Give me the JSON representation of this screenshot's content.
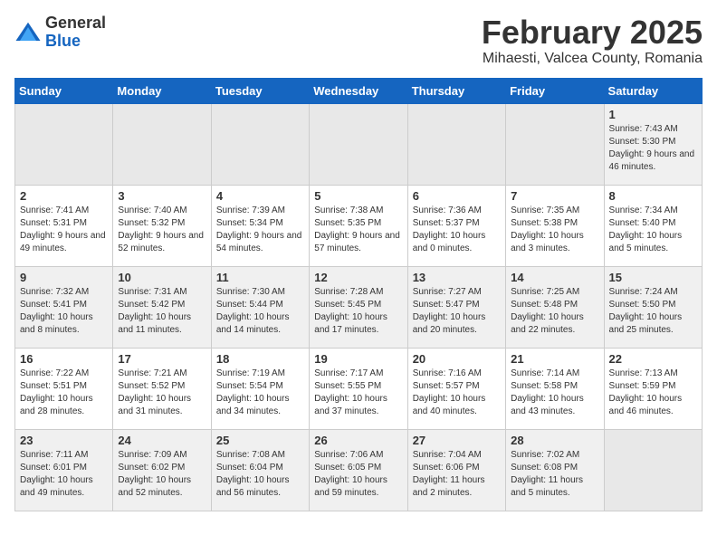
{
  "header": {
    "logo_general": "General",
    "logo_blue": "Blue",
    "title": "February 2025",
    "subtitle": "Mihaesti, Valcea County, Romania"
  },
  "weekdays": [
    "Sunday",
    "Monday",
    "Tuesday",
    "Wednesday",
    "Thursday",
    "Friday",
    "Saturday"
  ],
  "weeks": [
    [
      {
        "day": "",
        "empty": true
      },
      {
        "day": "",
        "empty": true
      },
      {
        "day": "",
        "empty": true
      },
      {
        "day": "",
        "empty": true
      },
      {
        "day": "",
        "empty": true
      },
      {
        "day": "",
        "empty": true
      },
      {
        "day": "1",
        "info": "Sunrise: 7:43 AM\nSunset: 5:30 PM\nDaylight: 9 hours and 46 minutes."
      }
    ],
    [
      {
        "day": "2",
        "info": "Sunrise: 7:41 AM\nSunset: 5:31 PM\nDaylight: 9 hours and 49 minutes."
      },
      {
        "day": "3",
        "info": "Sunrise: 7:40 AM\nSunset: 5:32 PM\nDaylight: 9 hours and 52 minutes."
      },
      {
        "day": "4",
        "info": "Sunrise: 7:39 AM\nSunset: 5:34 PM\nDaylight: 9 hours and 54 minutes."
      },
      {
        "day": "5",
        "info": "Sunrise: 7:38 AM\nSunset: 5:35 PM\nDaylight: 9 hours and 57 minutes."
      },
      {
        "day": "6",
        "info": "Sunrise: 7:36 AM\nSunset: 5:37 PM\nDaylight: 10 hours and 0 minutes."
      },
      {
        "day": "7",
        "info": "Sunrise: 7:35 AM\nSunset: 5:38 PM\nDaylight: 10 hours and 3 minutes."
      },
      {
        "day": "8",
        "info": "Sunrise: 7:34 AM\nSunset: 5:40 PM\nDaylight: 10 hours and 5 minutes."
      }
    ],
    [
      {
        "day": "9",
        "info": "Sunrise: 7:32 AM\nSunset: 5:41 PM\nDaylight: 10 hours and 8 minutes."
      },
      {
        "day": "10",
        "info": "Sunrise: 7:31 AM\nSunset: 5:42 PM\nDaylight: 10 hours and 11 minutes."
      },
      {
        "day": "11",
        "info": "Sunrise: 7:30 AM\nSunset: 5:44 PM\nDaylight: 10 hours and 14 minutes."
      },
      {
        "day": "12",
        "info": "Sunrise: 7:28 AM\nSunset: 5:45 PM\nDaylight: 10 hours and 17 minutes."
      },
      {
        "day": "13",
        "info": "Sunrise: 7:27 AM\nSunset: 5:47 PM\nDaylight: 10 hours and 20 minutes."
      },
      {
        "day": "14",
        "info": "Sunrise: 7:25 AM\nSunset: 5:48 PM\nDaylight: 10 hours and 22 minutes."
      },
      {
        "day": "15",
        "info": "Sunrise: 7:24 AM\nSunset: 5:50 PM\nDaylight: 10 hours and 25 minutes."
      }
    ],
    [
      {
        "day": "16",
        "info": "Sunrise: 7:22 AM\nSunset: 5:51 PM\nDaylight: 10 hours and 28 minutes."
      },
      {
        "day": "17",
        "info": "Sunrise: 7:21 AM\nSunset: 5:52 PM\nDaylight: 10 hours and 31 minutes."
      },
      {
        "day": "18",
        "info": "Sunrise: 7:19 AM\nSunset: 5:54 PM\nDaylight: 10 hours and 34 minutes."
      },
      {
        "day": "19",
        "info": "Sunrise: 7:17 AM\nSunset: 5:55 PM\nDaylight: 10 hours and 37 minutes."
      },
      {
        "day": "20",
        "info": "Sunrise: 7:16 AM\nSunset: 5:57 PM\nDaylight: 10 hours and 40 minutes."
      },
      {
        "day": "21",
        "info": "Sunrise: 7:14 AM\nSunset: 5:58 PM\nDaylight: 10 hours and 43 minutes."
      },
      {
        "day": "22",
        "info": "Sunrise: 7:13 AM\nSunset: 5:59 PM\nDaylight: 10 hours and 46 minutes."
      }
    ],
    [
      {
        "day": "23",
        "info": "Sunrise: 7:11 AM\nSunset: 6:01 PM\nDaylight: 10 hours and 49 minutes."
      },
      {
        "day": "24",
        "info": "Sunrise: 7:09 AM\nSunset: 6:02 PM\nDaylight: 10 hours and 52 minutes."
      },
      {
        "day": "25",
        "info": "Sunrise: 7:08 AM\nSunset: 6:04 PM\nDaylight: 10 hours and 56 minutes."
      },
      {
        "day": "26",
        "info": "Sunrise: 7:06 AM\nSunset: 6:05 PM\nDaylight: 10 hours and 59 minutes."
      },
      {
        "day": "27",
        "info": "Sunrise: 7:04 AM\nSunset: 6:06 PM\nDaylight: 11 hours and 2 minutes."
      },
      {
        "day": "28",
        "info": "Sunrise: 7:02 AM\nSunset: 6:08 PM\nDaylight: 11 hours and 5 minutes."
      },
      {
        "day": "",
        "empty": true
      }
    ]
  ]
}
